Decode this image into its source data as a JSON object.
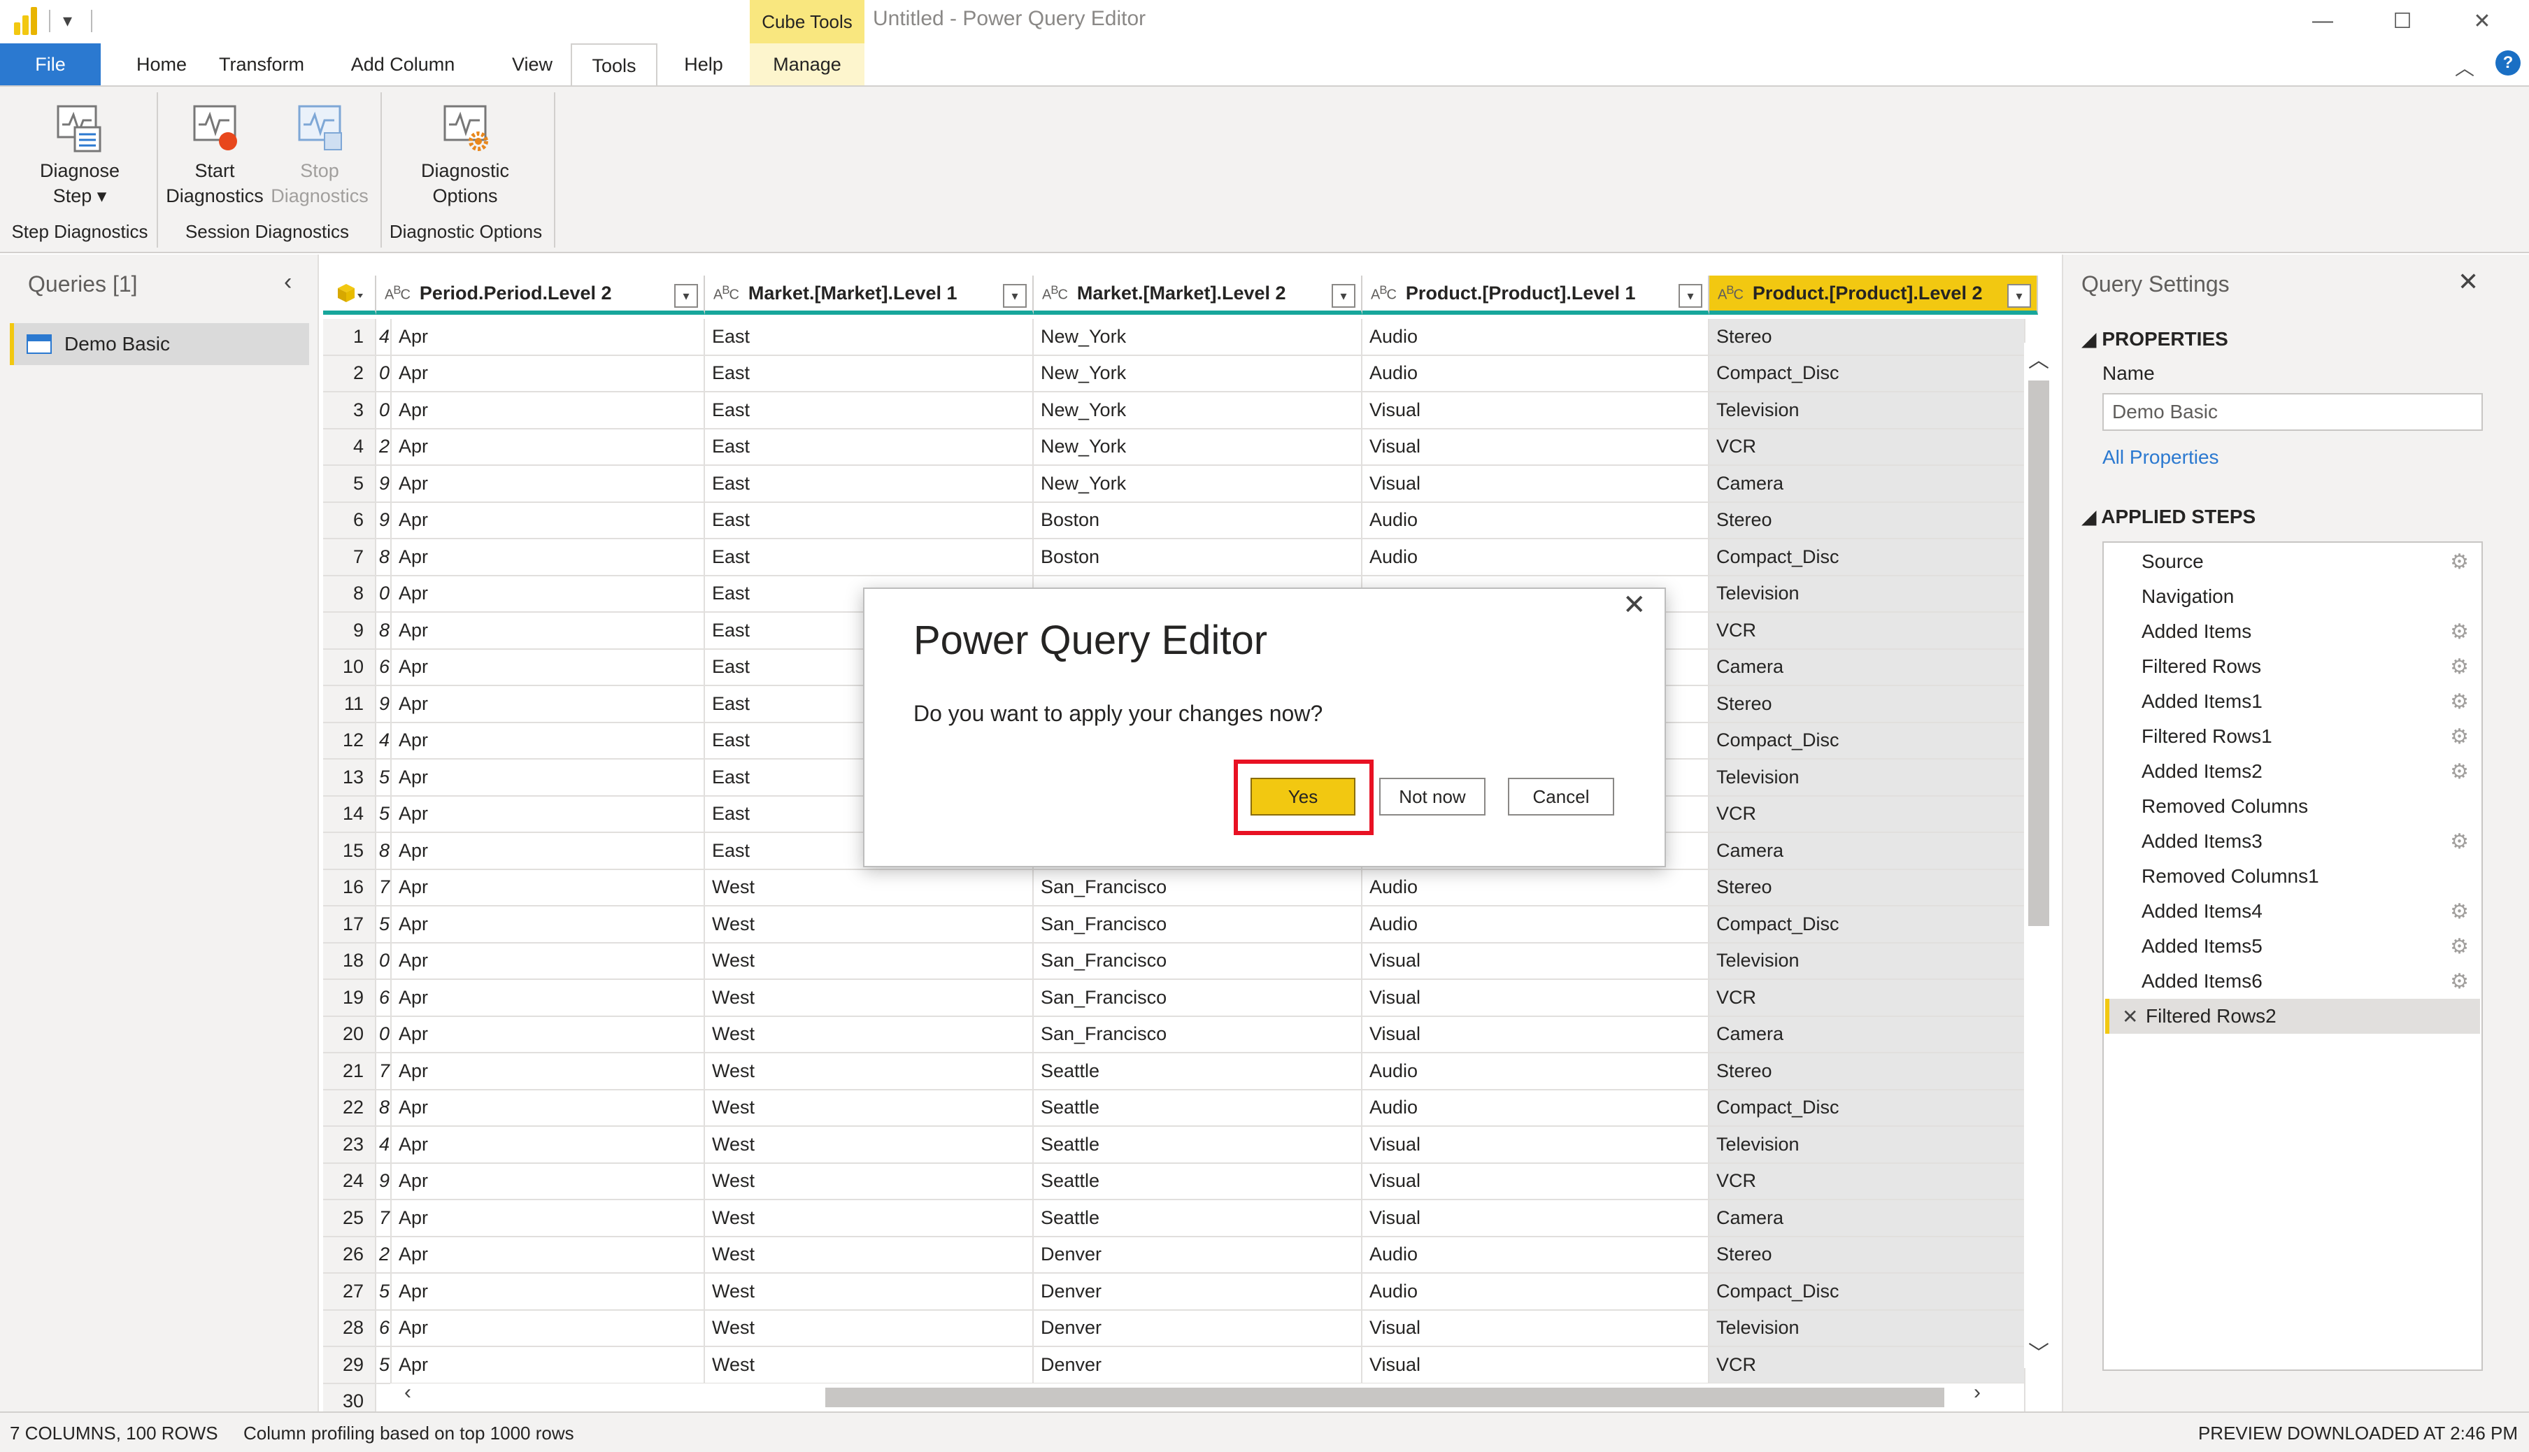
{
  "title_bar": {
    "context_tab": "Cube Tools",
    "window_title": "Untitled - Power Query Editor"
  },
  "tabs": [
    "File",
    "Home",
    "Transform",
    "Add Column",
    "View",
    "Tools",
    "Help",
    "Manage"
  ],
  "ribbon": {
    "diagnose_step": [
      "Diagnose",
      "Step"
    ],
    "start_diagnostics": [
      "Start",
      "Diagnostics"
    ],
    "stop_diagnostics": [
      "Stop",
      "Diagnostics"
    ],
    "diagnostic_options": [
      "Diagnostic",
      "Options"
    ],
    "groups": [
      "Step Diagnostics",
      "Session Diagnostics",
      "Diagnostic Options"
    ]
  },
  "queries": {
    "header": "Queries [1]",
    "items": [
      "Demo Basic"
    ]
  },
  "grid": {
    "columns": [
      "Period.Period.Level 2",
      "Market.[Market].Level 1",
      "Market.[Market].Level 2",
      "Product.[Product].Level 1",
      "Product.[Product].Level 2"
    ],
    "rows": [
      [
        "1",
        "4",
        "Apr",
        "East",
        "New_York",
        "Audio",
        "Stereo"
      ],
      [
        "2",
        "0",
        "Apr",
        "East",
        "New_York",
        "Audio",
        "Compact_Disc"
      ],
      [
        "3",
        "0",
        "Apr",
        "East",
        "New_York",
        "Visual",
        "Television"
      ],
      [
        "4",
        "2",
        "Apr",
        "East",
        "New_York",
        "Visual",
        "VCR"
      ],
      [
        "5",
        "9",
        "Apr",
        "East",
        "New_York",
        "Visual",
        "Camera"
      ],
      [
        "6",
        "9",
        "Apr",
        "East",
        "Boston",
        "Audio",
        "Stereo"
      ],
      [
        "7",
        "8",
        "Apr",
        "East",
        "Boston",
        "Audio",
        "Compact_Disc"
      ],
      [
        "8",
        "0",
        "Apr",
        "East",
        "",
        "",
        "Television"
      ],
      [
        "9",
        "8",
        "Apr",
        "East",
        "",
        "",
        "VCR"
      ],
      [
        "10",
        "6",
        "Apr",
        "East",
        "",
        "",
        "Camera"
      ],
      [
        "11",
        "9",
        "Apr",
        "East",
        "",
        "",
        "Stereo"
      ],
      [
        "12",
        "4",
        "Apr",
        "East",
        "",
        "",
        "Compact_Disc"
      ],
      [
        "13",
        "5",
        "Apr",
        "East",
        "",
        "",
        "Television"
      ],
      [
        "14",
        "5",
        "Apr",
        "East",
        "",
        "",
        "VCR"
      ],
      [
        "15",
        "8",
        "Apr",
        "East",
        "",
        "",
        "Camera"
      ],
      [
        "16",
        "7",
        "Apr",
        "West",
        "San_Francisco",
        "Audio",
        "Stereo"
      ],
      [
        "17",
        "5",
        "Apr",
        "West",
        "San_Francisco",
        "Audio",
        "Compact_Disc"
      ],
      [
        "18",
        "0",
        "Apr",
        "West",
        "San_Francisco",
        "Visual",
        "Television"
      ],
      [
        "19",
        "6",
        "Apr",
        "West",
        "San_Francisco",
        "Visual",
        "VCR"
      ],
      [
        "20",
        "0",
        "Apr",
        "West",
        "San_Francisco",
        "Visual",
        "Camera"
      ],
      [
        "21",
        "7",
        "Apr",
        "West",
        "Seattle",
        "Audio",
        "Stereo"
      ],
      [
        "22",
        "8",
        "Apr",
        "West",
        "Seattle",
        "Audio",
        "Compact_Disc"
      ],
      [
        "23",
        "4",
        "Apr",
        "West",
        "Seattle",
        "Visual",
        "Television"
      ],
      [
        "24",
        "9",
        "Apr",
        "West",
        "Seattle",
        "Visual",
        "VCR"
      ],
      [
        "25",
        "7",
        "Apr",
        "West",
        "Seattle",
        "Visual",
        "Camera"
      ],
      [
        "26",
        "2",
        "Apr",
        "West",
        "Denver",
        "Audio",
        "Stereo"
      ],
      [
        "27",
        "5",
        "Apr",
        "West",
        "Denver",
        "Audio",
        "Compact_Disc"
      ],
      [
        "28",
        "6",
        "Apr",
        "West",
        "Denver",
        "Visual",
        "Television"
      ],
      [
        "29",
        "5",
        "Apr",
        "West",
        "Denver",
        "Visual",
        "VCR"
      ],
      [
        "30",
        "",
        "",
        "",
        "",
        "",
        ""
      ]
    ]
  },
  "settings": {
    "title": "Query Settings",
    "properties_heading": "PROPERTIES",
    "name_label": "Name",
    "name_value": "Demo Basic",
    "all_properties": "All Properties",
    "steps_heading": "APPLIED STEPS",
    "steps": [
      {
        "label": "Source",
        "gear": true,
        "active": false
      },
      {
        "label": "Navigation",
        "gear": false,
        "active": false
      },
      {
        "label": "Added Items",
        "gear": true,
        "active": false
      },
      {
        "label": "Filtered Rows",
        "gear": true,
        "active": false
      },
      {
        "label": "Added Items1",
        "gear": true,
        "active": false
      },
      {
        "label": "Filtered Rows1",
        "gear": true,
        "active": false
      },
      {
        "label": "Added Items2",
        "gear": true,
        "active": false
      },
      {
        "label": "Removed Columns",
        "gear": false,
        "active": false
      },
      {
        "label": "Added Items3",
        "gear": true,
        "active": false
      },
      {
        "label": "Removed Columns1",
        "gear": false,
        "active": false
      },
      {
        "label": "Added Items4",
        "gear": true,
        "active": false
      },
      {
        "label": "Added Items5",
        "gear": true,
        "active": false
      },
      {
        "label": "Added Items6",
        "gear": true,
        "active": false
      },
      {
        "label": "Filtered Rows2",
        "gear": false,
        "active": true
      }
    ]
  },
  "status": {
    "columns_rows": "7 COLUMNS, 100 ROWS",
    "profiling": "Column profiling based on top 1000 rows",
    "preview": "PREVIEW DOWNLOADED AT 2:46 PM"
  },
  "dialog": {
    "title": "Power Query Editor",
    "message": "Do you want to apply your changes now?",
    "yes": "Yes",
    "not_now": "Not now",
    "cancel": "Cancel"
  },
  "colors": {
    "accent_yellow": "#f2c811",
    "file_tab_blue": "#2b79d0",
    "header_underline_teal": "#17a69b",
    "highlight_red": "#e81123"
  },
  "icons": [
    "power-bi-logo-icon",
    "dropdown-icon",
    "minimize-icon",
    "maximize-icon",
    "close-icon",
    "help-icon",
    "chevron-up-icon",
    "chevron-left-icon",
    "table-icon",
    "gear-icon",
    "abc-type-icon",
    "filter-dropdown-icon"
  ]
}
